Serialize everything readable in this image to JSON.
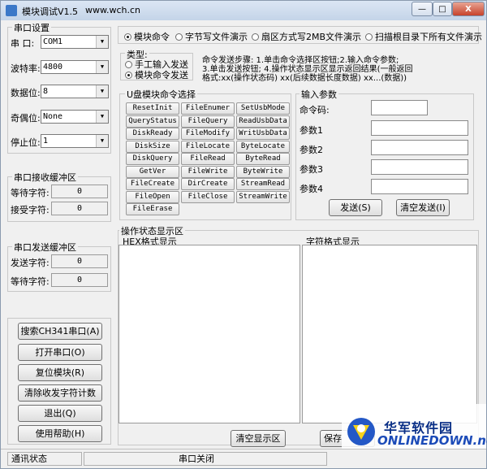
{
  "title": "模块调试V1.5",
  "site": "www.wch.cn",
  "window_buttons": {
    "minimize": "—",
    "maximize": "□",
    "close": "X"
  },
  "serial_settings": {
    "title": "串口设置",
    "port": {
      "label": "串 口:",
      "value": "COM1"
    },
    "baud": {
      "label": "波特率:",
      "value": "4800"
    },
    "databits": {
      "label": "数据位:",
      "value": "8"
    },
    "parity": {
      "label": "奇偶位:",
      "value": "None"
    },
    "stopbits": {
      "label": "停止位:",
      "value": "1"
    }
  },
  "rx_buffer": {
    "title": "串口接收缓冲区",
    "waiting": {
      "label": "等待字符:",
      "value": "0"
    },
    "received": {
      "label": "接受字符:",
      "value": "0"
    }
  },
  "tx_buffer": {
    "title": "串口发送缓冲区",
    "sent": {
      "label": "发送字符:",
      "value": "0"
    },
    "waiting": {
      "label": "等待字符:",
      "value": "0"
    }
  },
  "left_buttons": [
    {
      "name": "search-ch341-button",
      "label": "搜索CH341串口(A)"
    },
    {
      "name": "open-port-button",
      "label": "打开串口(O)"
    },
    {
      "name": "reset-module-button",
      "label": "复位模块(R)"
    },
    {
      "name": "clear-counter-button",
      "label": "清除收发字符计数"
    },
    {
      "name": "exit-button",
      "label": "退出(Q)"
    },
    {
      "name": "help-button",
      "label": "使用帮助(H)"
    }
  ],
  "mode_radios": [
    {
      "name": "radio-module-cmd",
      "label": "模块命令",
      "selected": true
    },
    {
      "name": "radio-byte-write",
      "label": "字节写文件演示",
      "selected": false
    },
    {
      "name": "radio-sector-write",
      "label": "扇区方式写2MB文件演示",
      "selected": false
    },
    {
      "name": "radio-scan-root",
      "label": "扫描根目录下所有文件演示",
      "selected": false
    }
  ],
  "type_box": {
    "title": "类型:",
    "options": [
      {
        "name": "radio-manual-input",
        "label": "手工输入发送",
        "selected": false
      },
      {
        "name": "radio-module-send",
        "label": "模块命令发送",
        "selected": true
      }
    ]
  },
  "instructions": [
    "命令发送步骤: 1.单击命令选择区按钮;2.输入命令参数;",
    "3.单击发送按钮; 4.操作状态显示区显示返回结果(一般返回",
    "格式:xx(操作状态码) xx(后续数据长度数据) xx...(数据))"
  ],
  "usb_commands": {
    "title": "U盘模块命令选择",
    "buttons": [
      "ResetInit",
      "FileEnumer",
      "SetUsbMode",
      "QueryStatus",
      "FileQuery",
      "ReadUsbData",
      "DiskReady",
      "FileModify",
      "WritUsbData",
      "DiskSize",
      "FileLocate",
      "ByteLocate",
      "DiskQuery",
      "FileRead",
      "ByteRead",
      "GetVer",
      "FileWrite",
      "ByteWrite",
      "FileCreate",
      "DirCreate",
      "StreamRead",
      "FileOpen",
      "FileClose",
      "StreamWrite",
      "FileErase"
    ]
  },
  "params": {
    "title": "输入参数",
    "cmd_label": "命令码:",
    "param_labels": [
      "参数1",
      "参数2",
      "参数3",
      "参数4"
    ],
    "send_label": "发送(S)",
    "clear_send_label": "清空发送(I)"
  },
  "status_area": {
    "title": "操作状态显示区",
    "hex_title": "HEX格式显示",
    "char_title": "字符格式显示",
    "clear_label": "清空显示区",
    "save_label": "保存"
  },
  "statusbar": {
    "comm_status": "通讯状态",
    "port_status": "串口关闭"
  },
  "watermark": {
    "cn": "华军软件园",
    "en": "ONLINEDOWN.net"
  }
}
